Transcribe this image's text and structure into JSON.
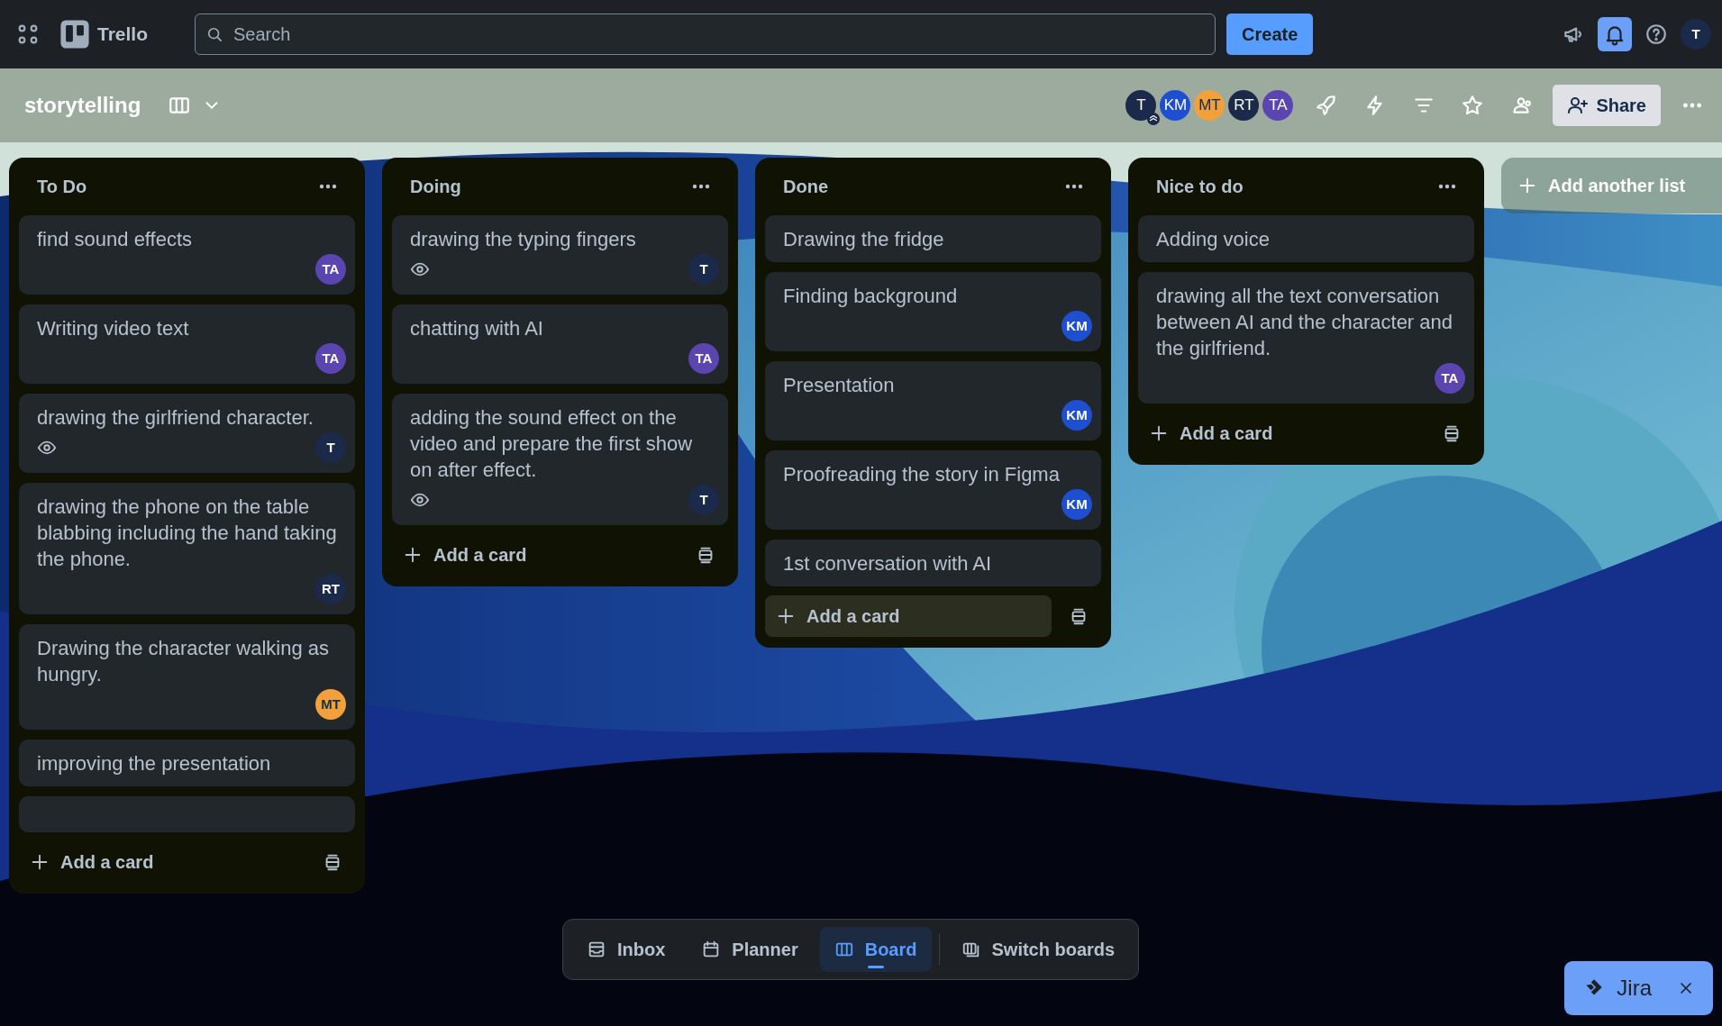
{
  "topbar": {
    "app_name": "Trello",
    "search": {
      "placeholder": "Search"
    },
    "create_button": "Create",
    "notifications_active": true,
    "user_avatar": {
      "initials": "T",
      "color": "#1b2a4a"
    }
  },
  "board": {
    "title": "storytelling",
    "members": [
      {
        "initials": "T",
        "color": "#1b2a4a",
        "admin": true
      },
      {
        "initials": "KM",
        "color": "#1f4fd1",
        "admin": false
      },
      {
        "initials": "MT",
        "color": "#f0a13c",
        "admin": false
      },
      {
        "initials": "RT",
        "color": "#1b2a4a",
        "admin": false
      },
      {
        "initials": "TA",
        "color": "#5b45b0",
        "admin": false
      }
    ],
    "share_button": "Share"
  },
  "lists": [
    {
      "title": "To Do",
      "cards": [
        {
          "title": "find sound effects",
          "watching": false,
          "member": {
            "initials": "TA",
            "color": "#5b45b0"
          }
        },
        {
          "title": "Writing video text",
          "watching": false,
          "member": {
            "initials": "TA",
            "color": "#5b45b0"
          }
        },
        {
          "title": "drawing the girlfriend character.",
          "watching": true,
          "member": {
            "initials": "T",
            "color": "#1b2a4a"
          }
        },
        {
          "title": "drawing the phone on the table blabbing including the hand taking the phone.",
          "watching": false,
          "member": {
            "initials": "RT",
            "color": "#1b2a4a"
          }
        },
        {
          "title": "Drawing the character walking as hungry.",
          "watching": false,
          "member": {
            "initials": "MT",
            "color": "#f0a13c"
          }
        },
        {
          "title": "improving the presentation",
          "watching": false
        }
      ],
      "more_cards_below": true,
      "add_card": "Add a card",
      "add_card_highlighted": false
    },
    {
      "title": "Doing",
      "cards": [
        {
          "title": "drawing the typing fingers",
          "watching": true,
          "member": {
            "initials": "T",
            "color": "#1b2a4a"
          }
        },
        {
          "title": "chatting with AI",
          "watching": false,
          "member": {
            "initials": "TA",
            "color": "#5b45b0"
          }
        },
        {
          "title": "adding the sound effect on the video and prepare the first show on after effect.",
          "watching": true,
          "member": {
            "initials": "T",
            "color": "#1b2a4a"
          }
        }
      ],
      "add_card": "Add a card",
      "add_card_highlighted": false
    },
    {
      "title": "Done",
      "cards": [
        {
          "title": "Drawing the fridge",
          "watching": false
        },
        {
          "title": "Finding background",
          "watching": false,
          "member": {
            "initials": "KM",
            "color": "#1f4fd1"
          }
        },
        {
          "title": "Presentation",
          "watching": false,
          "member": {
            "initials": "KM",
            "color": "#1f4fd1"
          }
        },
        {
          "title": "Proofreading the story in Figma",
          "watching": false,
          "member": {
            "initials": "KM",
            "color": "#1f4fd1"
          }
        },
        {
          "title": "1st conversation with AI",
          "watching": false
        }
      ],
      "add_card": "Add a card",
      "add_card_highlighted": true
    },
    {
      "title": "Nice to do",
      "cards": [
        {
          "title": "Adding voice",
          "watching": false
        },
        {
          "title": "drawing all the text conversation between AI and the character and the girlfriend.",
          "watching": false,
          "member": {
            "initials": "TA",
            "color": "#5b45b0"
          }
        }
      ],
      "add_card": "Add a card",
      "add_card_highlighted": false
    }
  ],
  "add_list": "Add another list",
  "bottom_nav": [
    {
      "label": "Inbox",
      "selected": false
    },
    {
      "label": "Planner",
      "selected": false
    },
    {
      "label": "Board",
      "selected": true
    },
    {
      "label": "Switch boards",
      "selected": false
    }
  ],
  "jira": {
    "label": "Jira"
  }
}
